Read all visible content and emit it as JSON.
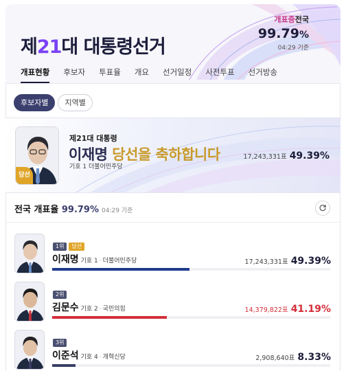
{
  "header": {
    "title_prefix": "제",
    "title_number": "21",
    "title_suffix": "대 대통령선거",
    "counting_label_a": "개표중",
    "counting_label_b": "전국",
    "counting_pct": "99.79",
    "counting_pct_unit": "%",
    "counting_time": "04:29 기준"
  },
  "tabs": [
    {
      "label": "개표현황",
      "active": true
    },
    {
      "label": "후보자"
    },
    {
      "label": "투표율"
    },
    {
      "label": "개요"
    },
    {
      "label": "선거일정"
    },
    {
      "label": "사전투표"
    },
    {
      "label": "선거방송"
    }
  ],
  "filters": [
    {
      "label": "후보자별",
      "active": true
    },
    {
      "label": "지역별"
    }
  ],
  "banner": {
    "subtitle": "제21대 대통령",
    "winner_name": "이재명",
    "congrats": "당선을 축하합니다",
    "info": "기호 1 더불어민주당",
    "votes": "17,243,331표",
    "pct": "49.39%",
    "elected_badge": "당선"
  },
  "section": {
    "title": "전국 개표율",
    "pct": "99.79",
    "pct_unit": "%",
    "time": "04:29 기준"
  },
  "candidates": [
    {
      "rank": "1위",
      "elected": "당선",
      "name": "이재명",
      "number": "기호 1",
      "party": "더불어민주당",
      "votes": "17,243,331표",
      "pct": "49.39%",
      "share": 49.39,
      "color": "#1f3c8c",
      "face": "#e6c8b0",
      "hair": "#2a2a30",
      "tie": "#6a8fc8"
    },
    {
      "rank": "2위",
      "elected": "",
      "name": "김문수",
      "number": "기호 2",
      "party": "국민의힘",
      "votes": "14,379,822표",
      "pct": "41.19%",
      "share": 41.19,
      "color": "#d32f3a",
      "face": "#dcb89a",
      "hair": "#1a1a1a",
      "tie": "#c8323c"
    },
    {
      "rank": "3위",
      "elected": "",
      "name": "이준석",
      "number": "기호 4",
      "party": "개혁신당",
      "votes": "2,908,640표",
      "pct": "8.33%",
      "share": 8.33,
      "color": "#3a3f66",
      "face": "#e2c2a6",
      "hair": "#222226",
      "tie": "#3a3f66"
    }
  ]
}
